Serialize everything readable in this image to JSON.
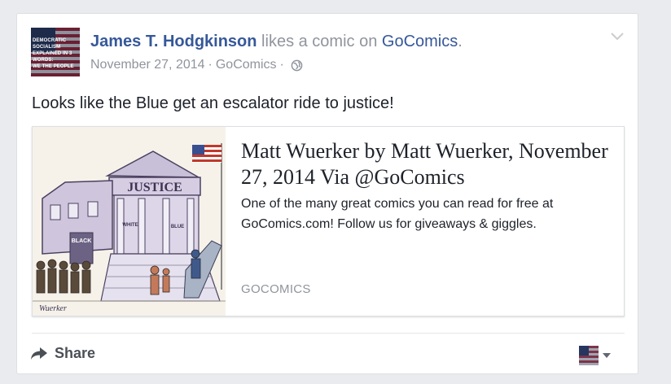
{
  "post": {
    "author_name": "James T. Hodgkinson",
    "action_text": " likes a comic on ",
    "page_name": "GoComics",
    "action_suffix": ".",
    "date": "November 27, 2014",
    "meta_separator": "·",
    "source": "GoComics",
    "privacy_icon": "globe-icon",
    "body_text": "Looks like the Blue get an escalator ride to justice!"
  },
  "avatar": {
    "lines": [
      "Democratic Socialism",
      "Explained in 3 Words:",
      "We The People"
    ]
  },
  "link_preview": {
    "title": "Matt Wuerker by Matt Wuerker, November 27, 2014 Via @GoComics",
    "description": "One of the many great comics you can read for free at GoComics.com! Follow us for giveaways & giggles.",
    "domain": "GOCOMICS",
    "image": {
      "building_sign": "JUSTICE",
      "door_left": "BLACK",
      "door_center": "WHITE",
      "door_right": "BLUE",
      "signature": "Wuerker"
    }
  },
  "actions": {
    "share_label": "Share",
    "share_icon": "share-arrow-icon",
    "audience_icon": "dropdown-caret-icon"
  },
  "colors": {
    "link": "#365899",
    "meta": "#90949c",
    "text": "#1d2129",
    "background": "#e9ebee"
  }
}
